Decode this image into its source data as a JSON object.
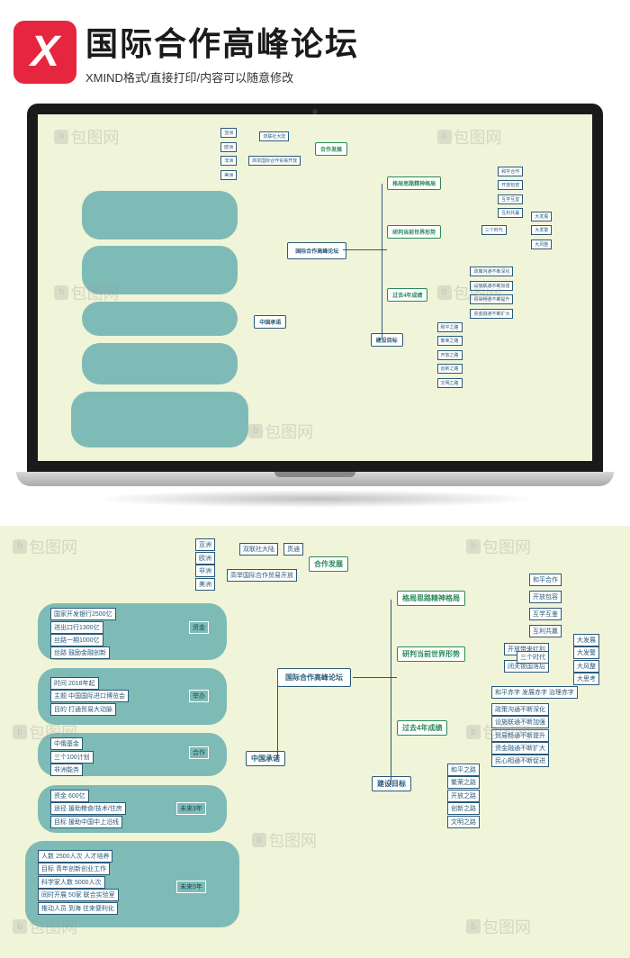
{
  "header": {
    "logo_letter": "X",
    "title": "国际合作高峰论坛",
    "subtitle": "XMIND格式/直接打印/内容可以随意修改"
  },
  "mindmap": {
    "center": "国际合作高峰论坛",
    "branches_right": [
      {
        "label": "合作发展"
      },
      {
        "label": "格局思路精神格局"
      },
      {
        "label": "研判当前世界形势"
      },
      {
        "label": "过去4年成绩"
      },
      {
        "label": "建设目标"
      }
    ],
    "branches_left": [
      {
        "label": "中国承诺"
      }
    ],
    "cooperation": {
      "items": [
        "亚洲",
        "欧洲",
        "非洲",
        "美洲"
      ],
      "detail1": "双联社大陆",
      "detail2": "贯通",
      "detail3": "高举国际合作贸易开放"
    },
    "spirit": {
      "items": [
        "和平合作",
        "开放包容",
        "互学互鉴",
        "互利共赢"
      ]
    },
    "world_situation": {
      "items": [
        "开放带来红利",
        "闭关锁国落后"
      ],
      "sub_label": "三个时代",
      "subs": [
        "大发展",
        "大发警",
        "大风整",
        "大思考"
      ],
      "extra": "和平赤字 发展赤字 治理赤字"
    },
    "past_achievements": {
      "items": [
        "政策沟通不断深化",
        "设施联通不断加强",
        "贸易畅通不断提升",
        "资金融通不断扩大",
        "民心相通不断促进"
      ]
    },
    "goals": {
      "items": [
        "和平之路",
        "繁荣之路",
        "开放之路",
        "创新之路",
        "文明之路"
      ]
    },
    "china_commitments": {
      "group1": {
        "label": "资金",
        "items": [
          "国家开发银行2500亿",
          "进出口行1300亿",
          "丝路一期1000亿",
          "丝路 鼓励金融创新"
        ]
      },
      "group2": {
        "label": "举办",
        "detail": "时间 2018年起",
        "items": [
          "主题 中国国际进口博览会",
          "目的 打通贸易大动脉"
        ]
      },
      "group3": {
        "label": "合作",
        "items": [
          "中俄基金",
          "三个100计划",
          "非洲能务"
        ]
      },
      "group4": {
        "label": "未来3年",
        "items": [
          "资金 600亿",
          "途径 援助粮食/技术/住房",
          "目标 援助中国中上沿线"
        ]
      },
      "group5": {
        "label": "未来5年",
        "items": [
          "人数 2500人次 人才培养",
          "目标 青年创新创业工作",
          "科学家人数 5000人次",
          "同时开展 50家 联合实验室",
          "推动人员 到海 往来便利化"
        ]
      }
    }
  },
  "watermark": "包图网"
}
